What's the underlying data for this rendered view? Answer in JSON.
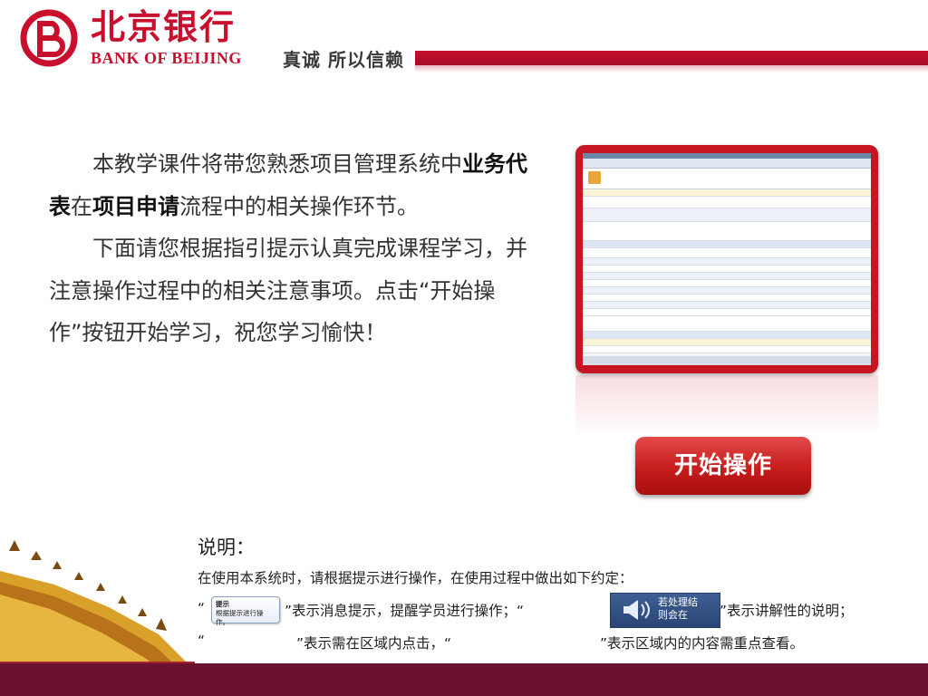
{
  "header": {
    "brand_cn": "北京银行",
    "brand_en": "BANK OF BEIJING",
    "slogan": "真诚  所以信赖",
    "logo_icon": "bank-of-beijing-logo-icon",
    "brand_color": "#c8102e"
  },
  "intro": {
    "p1_a": "本教学课件将带您熟悉项目管理系统中",
    "p1_b": "业务代表",
    "p1_c": "在",
    "p1_d": "项目申请",
    "p1_e": "流程中的相关操作环节。",
    "p2": "下面请您根据指引提示认真完成课程学习，并注意操作过程中的相关注意事项。点击“开始操作”按钮开始学习，祝您学习愉快！"
  },
  "start_button": {
    "label": "开始操作"
  },
  "notes": {
    "title": "说明：",
    "line1": "在使用本系统时，请根据提示进行操作，在使用过程中做出如下约定：",
    "line2_q_open": "“",
    "tip_sample_title": "提示",
    "tip_sample_body": "根据提示进行操作。",
    "line2_mid": "”表示消息提示，提醒学员进行操作；“",
    "explain_sample_text": "若处理结\n则会在",
    "line2_end": "”表示讲解性的说明；",
    "line3_q1": "“",
    "line3_mid": "”表示需在区域内点击，“",
    "line3_end": "”表示区域内的内容需重点查看。"
  },
  "footer": {
    "color": "#6a1230"
  }
}
